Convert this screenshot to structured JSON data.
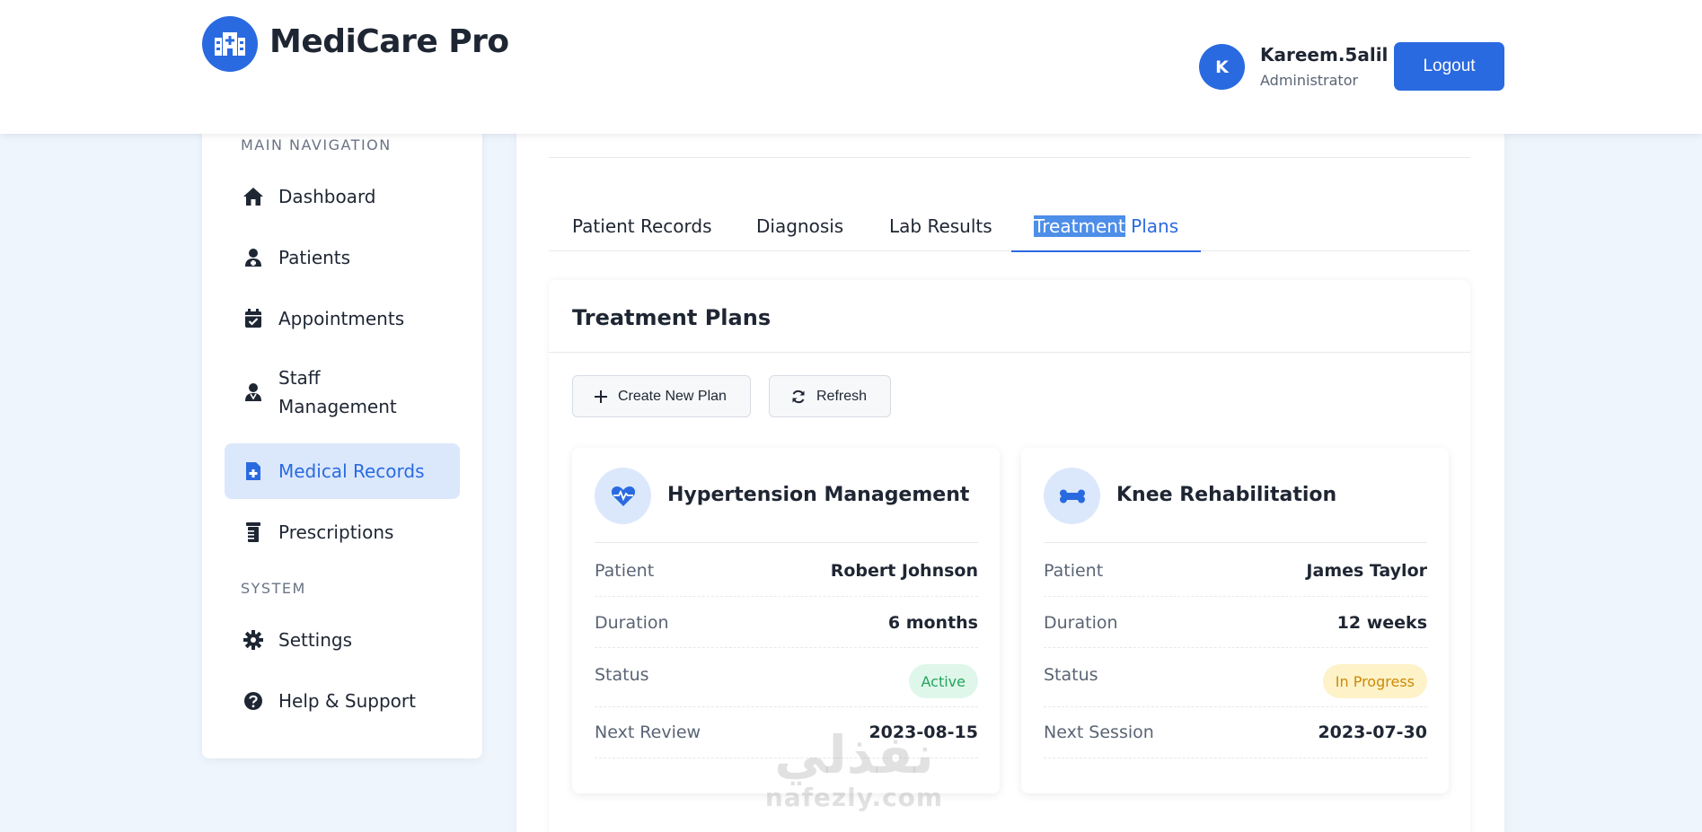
{
  "header": {
    "app_name": "MediCare Pro",
    "user_initial": "K",
    "user_name": "Kareem.5alil",
    "user_role": "Administrator",
    "logout_label": "Logout"
  },
  "sidebar": {
    "section_main": "MAIN NAVIGATION",
    "section_system": "SYSTEM",
    "items": [
      {
        "label": "Dashboard",
        "icon": "home-icon"
      },
      {
        "label": "Patients",
        "icon": "patient-icon"
      },
      {
        "label": "Appointments",
        "icon": "calendar-check-icon"
      },
      {
        "label": "Staff Management",
        "icon": "staff-icon"
      },
      {
        "label": "Medical Records",
        "icon": "medical-file-icon",
        "active": true
      },
      {
        "label": "Prescriptions",
        "icon": "prescription-bottle-icon"
      }
    ],
    "system_items": [
      {
        "label": "Settings",
        "icon": "gear-icon"
      },
      {
        "label": "Help & Support",
        "icon": "question-circle-icon"
      }
    ]
  },
  "tabs": {
    "patient_records": "Patient Records",
    "diagnosis": "Diagnosis",
    "lab_results": "Lab Results",
    "treatment_sel": "Treatment",
    "treatment_rest": " Plans"
  },
  "panel": {
    "title": "Treatment Plans",
    "create_label": "Create New Plan",
    "refresh_label": "Refresh"
  },
  "plans": [
    {
      "title": "Hypertension Management",
      "icon": "heartbeat-icon",
      "patient_label": "Patient",
      "patient": "Robert Johnson",
      "duration_label": "Duration",
      "duration": "6 months",
      "status_label": "Status",
      "status": "Active",
      "next_label": "Next Review",
      "next": "2023-08-15"
    },
    {
      "title": "Knee Rehabilitation",
      "icon": "bone-icon",
      "patient_label": "Patient",
      "patient": "James Taylor",
      "duration_label": "Duration",
      "duration": "12 weeks",
      "status_label": "Status",
      "status": "In Progress",
      "next_label": "Next Session",
      "next": "2023-07-30"
    }
  ],
  "watermark": {
    "arabic": "نفذلي",
    "latin": "nafezly.com"
  },
  "colors": {
    "primary": "#2a6ae0",
    "active_badge_bg": "#dff7ea",
    "active_badge_text": "#22a45c",
    "progress_badge_bg": "#fdf2c8",
    "progress_badge_text": "#cc8a05"
  }
}
